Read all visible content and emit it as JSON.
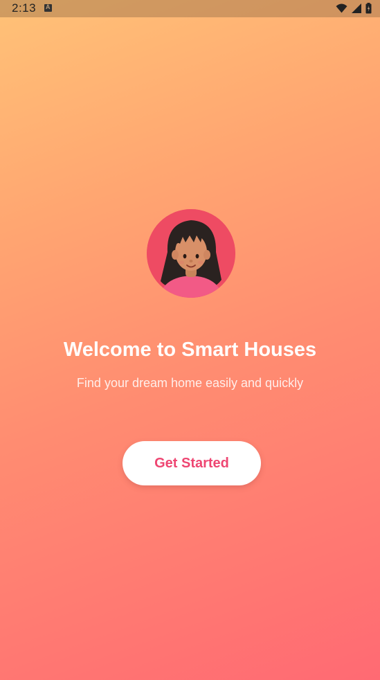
{
  "status_bar": {
    "time": "2:13",
    "icons": [
      "notification-a-icon",
      "wifi-icon",
      "signal-icon",
      "battery-icon"
    ]
  },
  "avatar": {
    "description_icon": "woman-avatar-3d",
    "background_color": "#ee4b63"
  },
  "welcome": {
    "title": "Welcome to Smart Houses",
    "subtitle": "Find your dream home easily and quickly"
  },
  "cta": {
    "label": "Get Started",
    "color": "#ee4672"
  },
  "colors": {
    "gradient_start": "#ffc277",
    "gradient_end": "#ff6a73"
  }
}
